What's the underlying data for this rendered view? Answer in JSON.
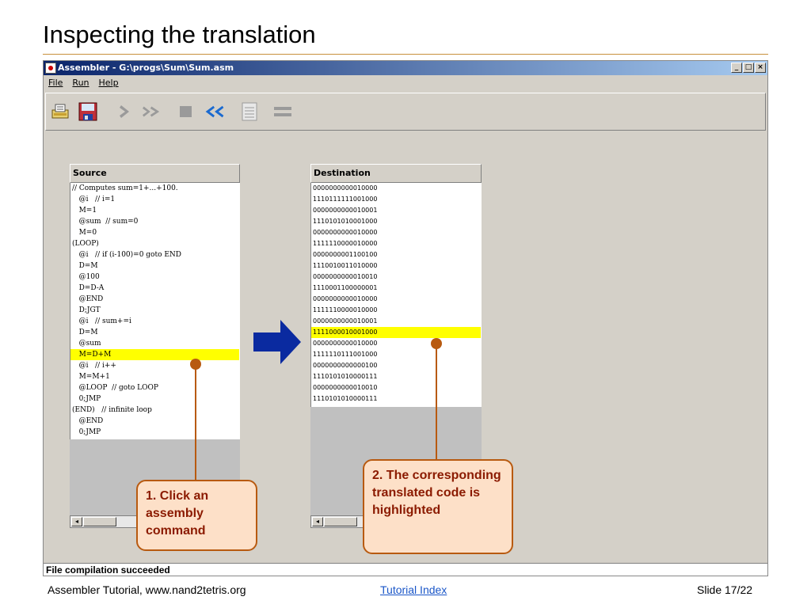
{
  "slide": {
    "title": "Inspecting the translation",
    "footer_left": "Assembler Tutorial, www.nand2tetris.org",
    "footer_link": "Tutorial Index",
    "footer_right": "Slide 17/22"
  },
  "window": {
    "title": "Assembler - G:\\progs\\Sum\\Sum.asm",
    "controls": [
      "_",
      "□",
      "×"
    ]
  },
  "menu": [
    "File",
    "Run",
    "Help"
  ],
  "toolbar": {
    "icons": [
      "load-program-icon",
      "save-icon",
      "single-step-icon",
      "fast-forward-icon",
      "stop-icon",
      "rewind-icon",
      "load-compare-file-icon",
      "equals-icon"
    ]
  },
  "source": {
    "header": "Source",
    "highlight_index": 15,
    "lines": [
      "// Computes sum=1+...+100.",
      "   @i   // i=1",
      "   M=1",
      "   @sum  // sum=0",
      "   M=0",
      "(LOOP)",
      "   @i   // if (i-100)=0 goto END",
      "   D=M",
      "   @100",
      "   D=D-A",
      "   @END",
      "   D;JGT",
      "   @i   // sum+=i",
      "   D=M",
      "   @sum",
      "   M=D+M",
      "   @i   // i++",
      "   M=M+1",
      "   @LOOP  // goto LOOP",
      "   0;JMP",
      "(END)   // infinite loop",
      "   @END",
      "   0;JMP"
    ]
  },
  "destination": {
    "header": "Destination",
    "highlight_index": 13,
    "lines": [
      "0000000000010000",
      "1110111111001000",
      "0000000000010001",
      "1110101010001000",
      "0000000000010000",
      "1111110000010000",
      "0000000001100100",
      "1110010011010000",
      "0000000000010010",
      "1110001100000001",
      "0000000000010000",
      "1111110000010000",
      "0000000000010001",
      "1111000010001000",
      "0000000000010000",
      "1111110111001000",
      "0000000000000100",
      "1110101010000111",
      "0000000000010010",
      "1110101010000111"
    ]
  },
  "status": "File compilation succeeded",
  "callouts": {
    "one": "1. Click an assembly command",
    "two": "2. The corresponding translated code is highlighted"
  },
  "colors": {
    "highlight": "#ffff00",
    "callout_fill": "#fde0c8",
    "callout_border": "#b85a10",
    "callout_text": "#8b1a00",
    "arrow": "#0a2aa0",
    "title_rule": "#c8903c"
  }
}
